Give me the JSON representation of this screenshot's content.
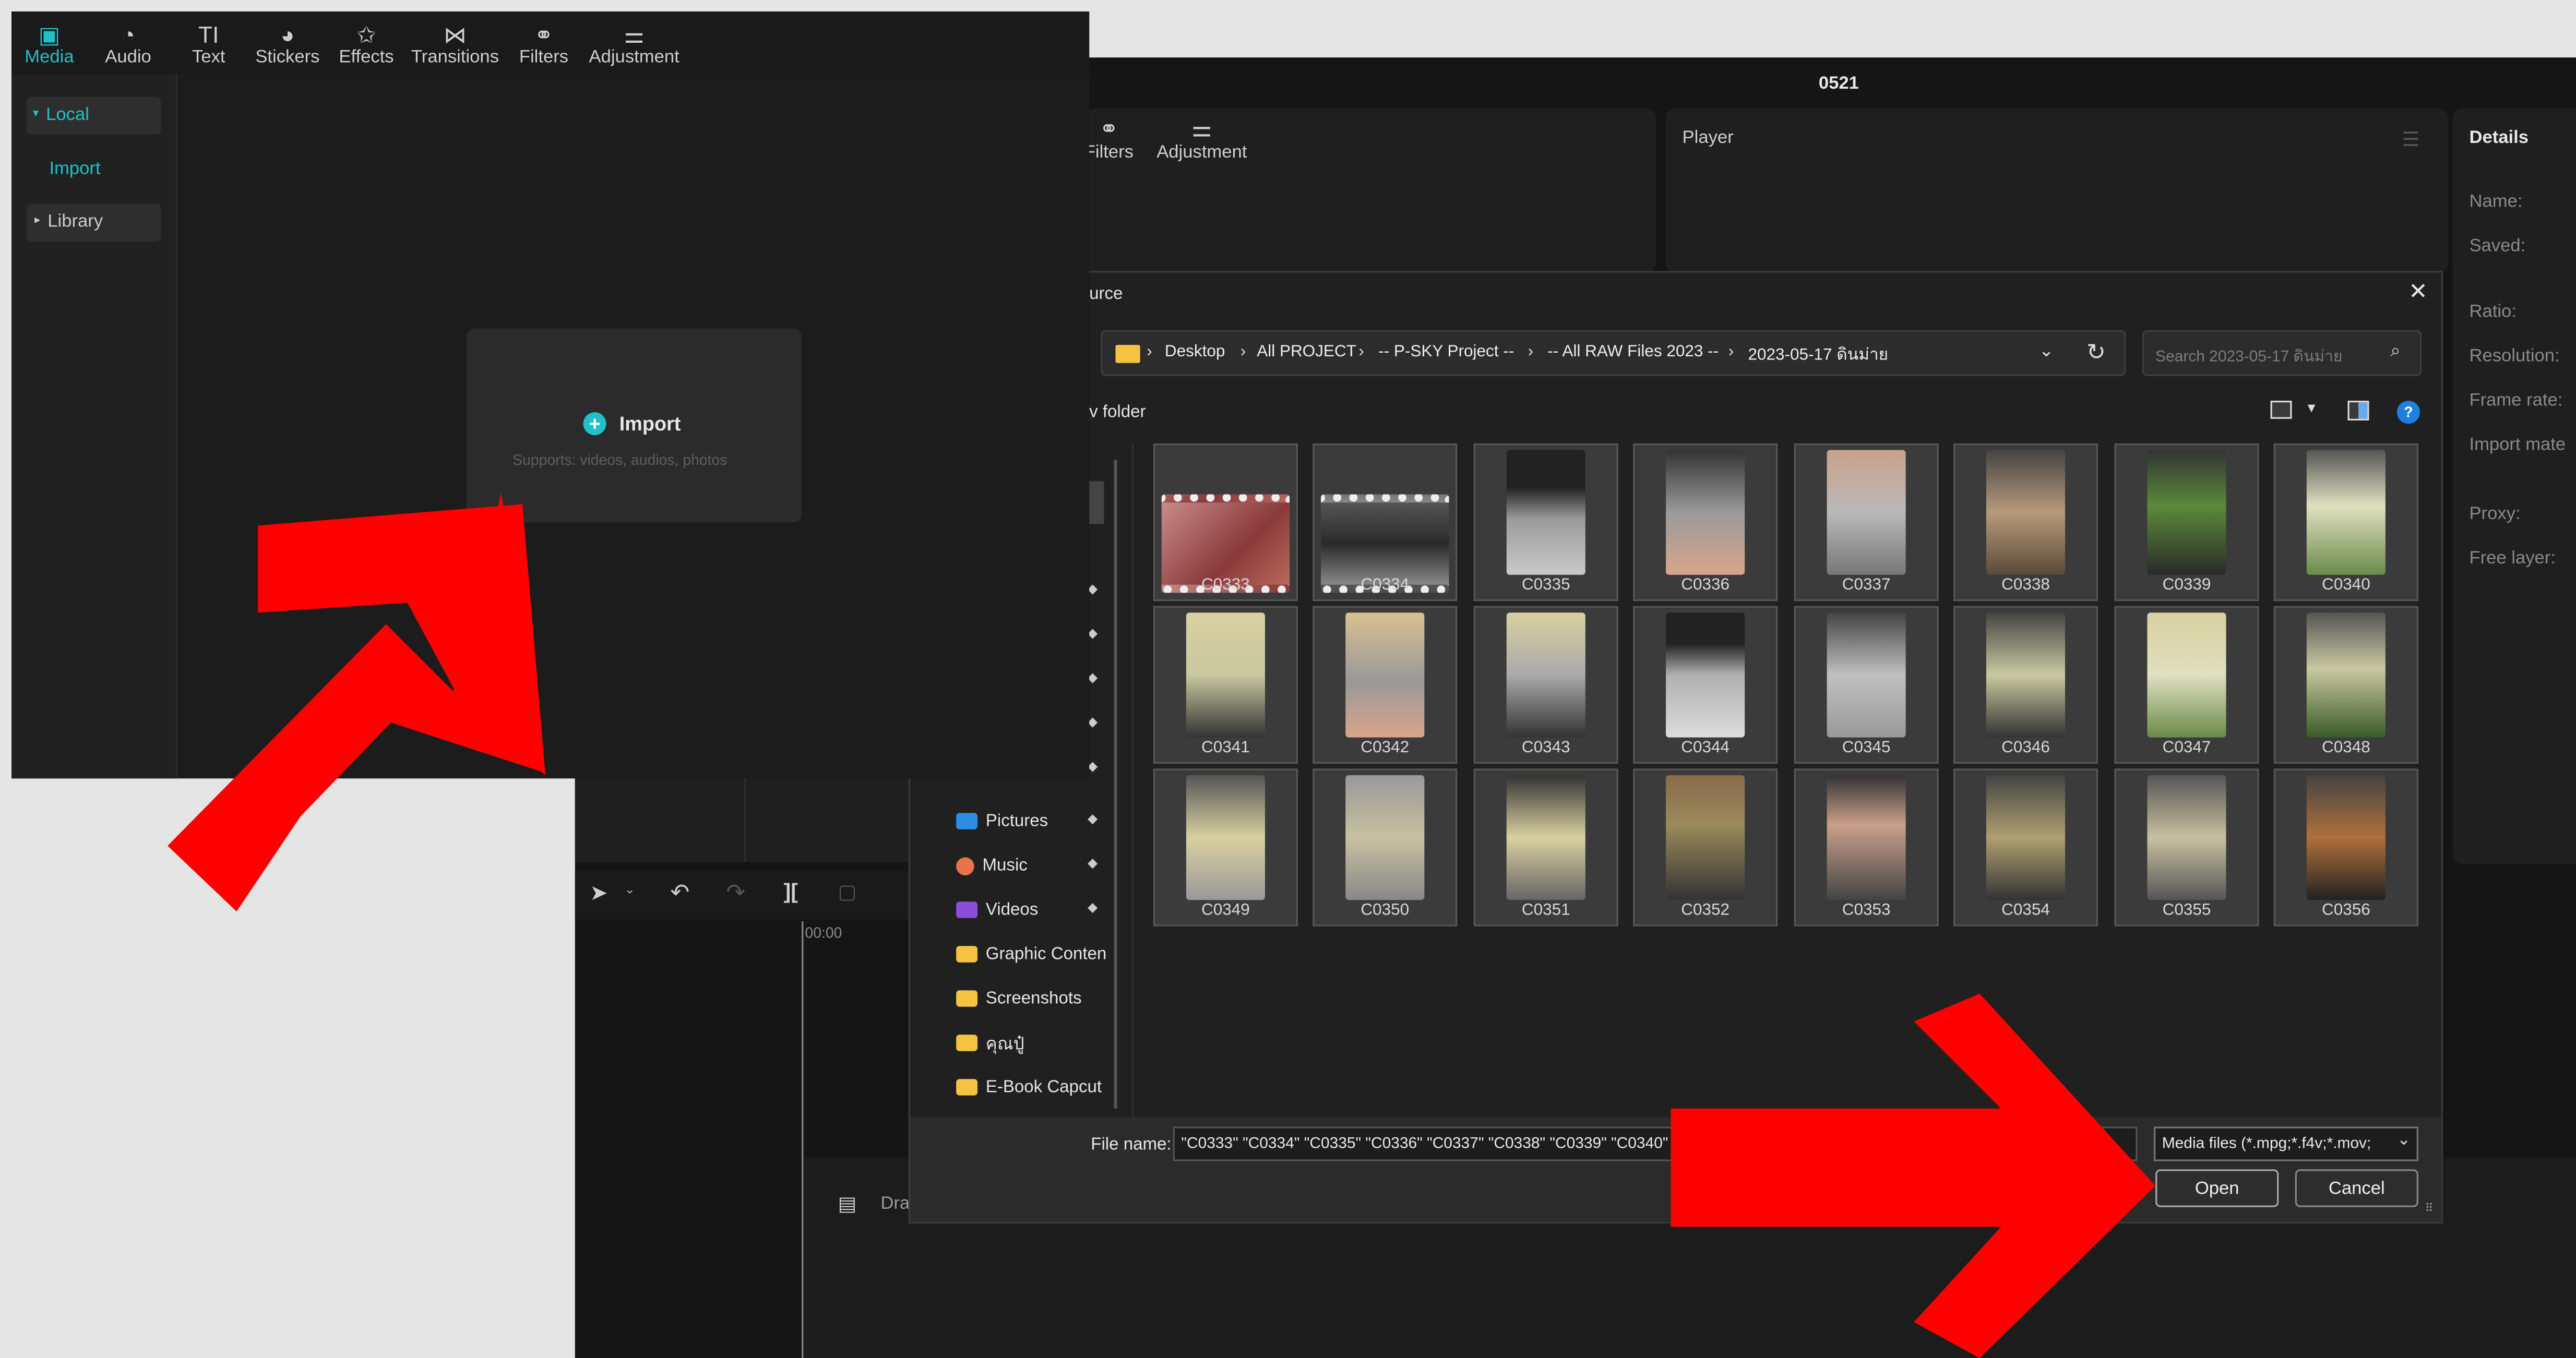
{
  "back_window": {
    "title": "0521",
    "toolbar": {
      "filters_label": "Filters",
      "adjustment_label": "Adjustment"
    },
    "player": {
      "title": "Player"
    },
    "details": {
      "title": "Details",
      "fields": [
        "Name:",
        "Saved:",
        "Ratio:",
        "Resolution:",
        "Frame rate:",
        "Import mate",
        "Proxy:",
        "Free layer:"
      ]
    },
    "timeline": {
      "time": "00:00",
      "drag_hint": "Dra"
    }
  },
  "dialog": {
    "title": "urce",
    "breadcrumb": [
      "Desktop",
      "All PROJECT",
      "-- P-SKY Project --",
      "-- All RAW Files 2023 --",
      "2023-05-17 ดินม่าย"
    ],
    "search_placeholder": "Search 2023-05-17 ดินม่าย",
    "new_folder_label": "v folder",
    "sidebar": [
      {
        "label": "Pictures",
        "icon": "pictures-icon",
        "pinned": true
      },
      {
        "label": "Music",
        "icon": "music-icon",
        "pinned": true
      },
      {
        "label": "Videos",
        "icon": "videos-icon",
        "pinned": true
      },
      {
        "label": "Graphic Conten",
        "icon": "folder-icon",
        "pinned": false
      },
      {
        "label": "Screenshots",
        "icon": "folder-icon",
        "pinned": false
      },
      {
        "label": "คุณปู๋",
        "icon": "folder-icon",
        "pinned": false
      },
      {
        "label": "E-Book Capcut",
        "icon": "folder-icon",
        "pinned": false
      }
    ],
    "files": [
      "C0333",
      "C0334",
      "C0335",
      "C0336",
      "C0337",
      "C0338",
      "C0339",
      "C0340",
      "C0341",
      "C0342",
      "C0343",
      "C0344",
      "C0345",
      "C0346",
      "C0347",
      "C0348",
      "C0349",
      "C0350",
      "C0351",
      "C0352",
      "C0353",
      "C0354",
      "C0355",
      "C0356"
    ],
    "file_name_label": "File name:",
    "file_name_value": "\"C0333\" \"C0334\" \"C0335\" \"C0336\" \"C0337\" \"C0338\" \"C0339\" \"C0340\"",
    "file_type": "Media files (*.mpg;*.f4v;*.mov;",
    "open_label": "Open",
    "cancel_label": "Cancel"
  },
  "capcut": {
    "tabs": [
      {
        "label": "Media",
        "icon": "media-icon",
        "active": true
      },
      {
        "label": "Audio",
        "icon": "audio-icon",
        "active": false
      },
      {
        "label": "Text",
        "icon": "text-icon",
        "active": false
      },
      {
        "label": "Stickers",
        "icon": "stickers-icon",
        "active": false
      },
      {
        "label": "Effects",
        "icon": "effects-icon",
        "active": false
      },
      {
        "label": "Transitions",
        "icon": "transitions-icon",
        "active": false
      },
      {
        "label": "Filters",
        "icon": "filters-icon",
        "active": false
      },
      {
        "label": "Adjustment",
        "icon": "adjustment-icon",
        "active": false
      }
    ],
    "sidebar": {
      "local": "Local",
      "import": "Import",
      "library": "Library"
    },
    "import_box": {
      "label": "Import",
      "hint": "Supports: videos, audios, photos"
    }
  },
  "colors": {
    "accent": "#1fc2c8",
    "arrow": "#ff0000"
  }
}
